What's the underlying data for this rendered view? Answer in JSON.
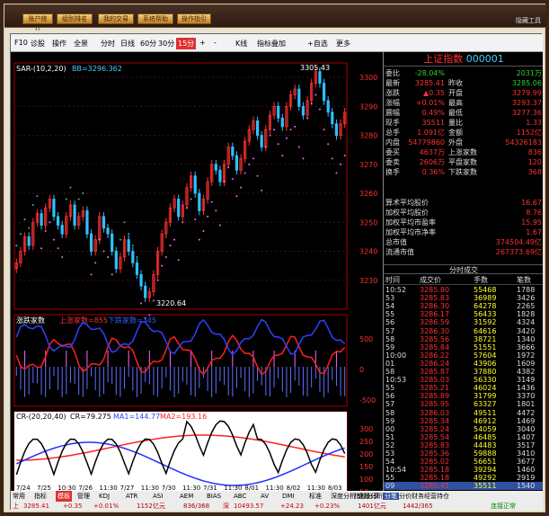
{
  "topbar": {
    "buttons": [
      "账户统计",
      "组别排名",
      "我的交易",
      "系统帮助",
      "操作指引"
    ],
    "right_label": "隐藏工具"
  },
  "toolbar": {
    "items": [
      "F10",
      "诊股",
      "操作",
      "全景",
      "分时",
      "日线",
      "60分",
      "30分",
      "15分",
      "+",
      "-",
      "K线",
      "指标叠加",
      "+自选",
      "更多"
    ],
    "active": "15分",
    "code_prefix": "DB"
  },
  "quote": {
    "title": "上证指数",
    "code": "000001",
    "rows": [
      {
        "l": "委比",
        "v": "-28.04%",
        "l2": "",
        "v2": "2031万"
      },
      {
        "l": "最新",
        "v": "3285.41",
        "l2": "昨收",
        "v2": "3285.06"
      },
      {
        "l": "涨跌",
        "v": "▲0.35",
        "l2": "开盘",
        "v2": "3279.99"
      },
      {
        "l": "涨幅",
        "v": "+0.01%",
        "l2": "最高",
        "v2": "3293.37"
      },
      {
        "l": "震幅",
        "v": "0.49%",
        "l2": "最低",
        "v2": "3277.36"
      },
      {
        "l": "现手",
        "v": "35511",
        "l2": "量比",
        "v2": "1.33"
      },
      {
        "l": "总手",
        "v": "1.091亿",
        "l2": "金额",
        "v2": "1152亿"
      },
      {
        "l": "内盘",
        "v": "54779860",
        "l2": "外盘",
        "v2": "54326183"
      },
      {
        "l": "委买",
        "v": "4637万",
        "l2": "上涨家数",
        "v2": "836"
      },
      {
        "l": "委卖",
        "v": "2606万",
        "l2": "平盘家数",
        "v2": "120"
      },
      {
        "l": "换手",
        "v": "0.36%",
        "l2": "下跌家数",
        "v2": "368"
      }
    ],
    "stats": [
      {
        "l": "算术平均股价",
        "v": "16.67"
      },
      {
        "l": "加权平均股价",
        "v": "8.76"
      },
      {
        "l": "加权平均市盈率",
        "v": "15.95"
      },
      {
        "l": "加权平均市净率",
        "v": "1.67"
      },
      {
        "l": "总市值",
        "v": "374504.49亿"
      },
      {
        "l": "流通市值",
        "v": "267373.69亿"
      }
    ],
    "ticks_title": "分时成交",
    "tick_headers": [
      "时间",
      "成交价",
      "手数",
      "笔数"
    ],
    "ticks": [
      [
        "10:52",
        "3285.80",
        "55468",
        "1788"
      ],
      [
        "53",
        "3285.83",
        "36989",
        "3426"
      ],
      [
        "54",
        "3286.30",
        "64278",
        "2265"
      ],
      [
        "55",
        "3286.17",
        "56433",
        "1828"
      ],
      [
        "56",
        "3286.59",
        "31592",
        "4324"
      ],
      [
        "57",
        "3286.30",
        "64616",
        "3420"
      ],
      [
        "58",
        "3285.56",
        "38721",
        "1340"
      ],
      [
        "59",
        "3285.84",
        "51551",
        "3666"
      ],
      [
        "10:00",
        "3286.22",
        "57604",
        "1972"
      ],
      [
        "01",
        "3286.24",
        "43906",
        "1609"
      ],
      [
        "58",
        "3285.87",
        "37880",
        "4382"
      ],
      [
        "10:53",
        "3285.03",
        "56330",
        "3149"
      ],
      [
        "55",
        "3285.21",
        "46024",
        "1436"
      ],
      [
        "56",
        "3285.89",
        "31799",
        "3370"
      ],
      [
        "57",
        "3285.95",
        "63327",
        "1801"
      ],
      [
        "58",
        "3286.03",
        "49511",
        "4472"
      ],
      [
        "59",
        "3285.34",
        "46912",
        "1469"
      ],
      [
        "00",
        "3285.24",
        "54059",
        "3040"
      ],
      [
        "51",
        "3285.54",
        "46485",
        "1407"
      ],
      [
        "52",
        "3285.83",
        "44483",
        "3517"
      ],
      [
        "53",
        "3285.36",
        "59888",
        "3410"
      ],
      [
        "54",
        "3285.02",
        "56651",
        "3677"
      ],
      [
        "10:54",
        "3285.18",
        "39294",
        "1460"
      ],
      [
        "55",
        "3285.18",
        "49292",
        "2919"
      ],
      [
        "09",
        "3285.41",
        "35511",
        "1540"
      ]
    ],
    "tabs": [
      "分笔",
      "分价",
      "财务",
      "经营",
      "持仓"
    ]
  },
  "chart_data": [
    {
      "type": "candlestick",
      "title": "SAR-(10,2,20)",
      "legend": "BB=3296.362",
      "ylim": [
        3220,
        3305
      ],
      "yticks": [
        3230,
        3240,
        3250,
        3260,
        3270,
        3280,
        3290,
        3300
      ],
      "ylabels": [
        "3230",
        "3240",
        "3250",
        "3260",
        "3270",
        "3280",
        "3290",
        "3300"
      ],
      "annotations": {
        "high": "3305.43",
        "low": "3220.64"
      },
      "closes": [
        3236,
        3240,
        3245,
        3242,
        3250,
        3253,
        3249,
        3255,
        3258,
        3252,
        3249,
        3246,
        3252,
        3256,
        3249,
        3252,
        3254,
        3246,
        3240,
        3244,
        3252,
        3248,
        3246,
        3240,
        3234,
        3238,
        3244,
        3240,
        3236,
        3232,
        3228,
        3224,
        3226,
        3232,
        3240,
        3246,
        3250,
        3255,
        3258,
        3252,
        3256,
        3262,
        3266,
        3260,
        3254,
        3258,
        3264,
        3270,
        3268,
        3264,
        3270,
        3276,
        3273,
        3268,
        3272,
        3278,
        3282,
        3285,
        3280,
        3276,
        3282,
        3287,
        3290,
        3286,
        3283,
        3290,
        3294,
        3296,
        3290,
        3287,
        3292,
        3298,
        3302,
        3298,
        3292,
        3288,
        3284,
        3280,
        3284,
        3288
      ]
    },
    {
      "type": "line",
      "title": "涨跌家数",
      "series": [
        {
          "name": "上涨家数=855"
        },
        {
          "name": "下跌家数=345"
        }
      ],
      "ylabels": [
        "500",
        "0",
        "-500"
      ]
    },
    {
      "type": "line",
      "title": "CR-(20,20,40)",
      "series": [
        {
          "name": "CR=79.275"
        },
        {
          "name": "MA1=144.77"
        },
        {
          "name": "MA2=193.16"
        }
      ],
      "ylabels": [
        "300",
        "250",
        "200",
        "150",
        "100",
        "50"
      ]
    }
  ],
  "xlabels": [
    "7/24",
    "7/25",
    "10:30",
    "7/26",
    "11:30",
    "7/27",
    "11:30",
    "7/30",
    "11:30",
    "7/31",
    "11:30",
    "8/01",
    "11:30",
    "8/02",
    "11:30",
    "8/03"
  ],
  "bottom_tabs": [
    "常用",
    "指标",
    "模板",
    "管理",
    "KDJ",
    "ATR",
    "ASI",
    "AEM",
    "BIAS",
    "ABC",
    "AV",
    "DMI",
    "标准",
    "深度分析",
    "盘播分析"
  ],
  "indicator_btn": "指标分享",
  "status": {
    "idx1": "上",
    "v1": "3285.41",
    "c1": "+0.35",
    "p1": "+0.01%",
    "a1": "1152亿元",
    "n1": "836/368",
    "idx2": "深",
    "v2": "10493.57",
    "c2": "+24.23",
    "p2": "+0.23%",
    "a2": "1401亿元",
    "n2": "1442/365",
    "conn": "连接正常"
  },
  "colors": {
    "up": "#ff3030",
    "down": "#30c0ff",
    "red": "#ff3030",
    "green": "#30d030",
    "yellow": "#ffff30",
    "blue": "#3050ff",
    "accent": "#e03030"
  }
}
